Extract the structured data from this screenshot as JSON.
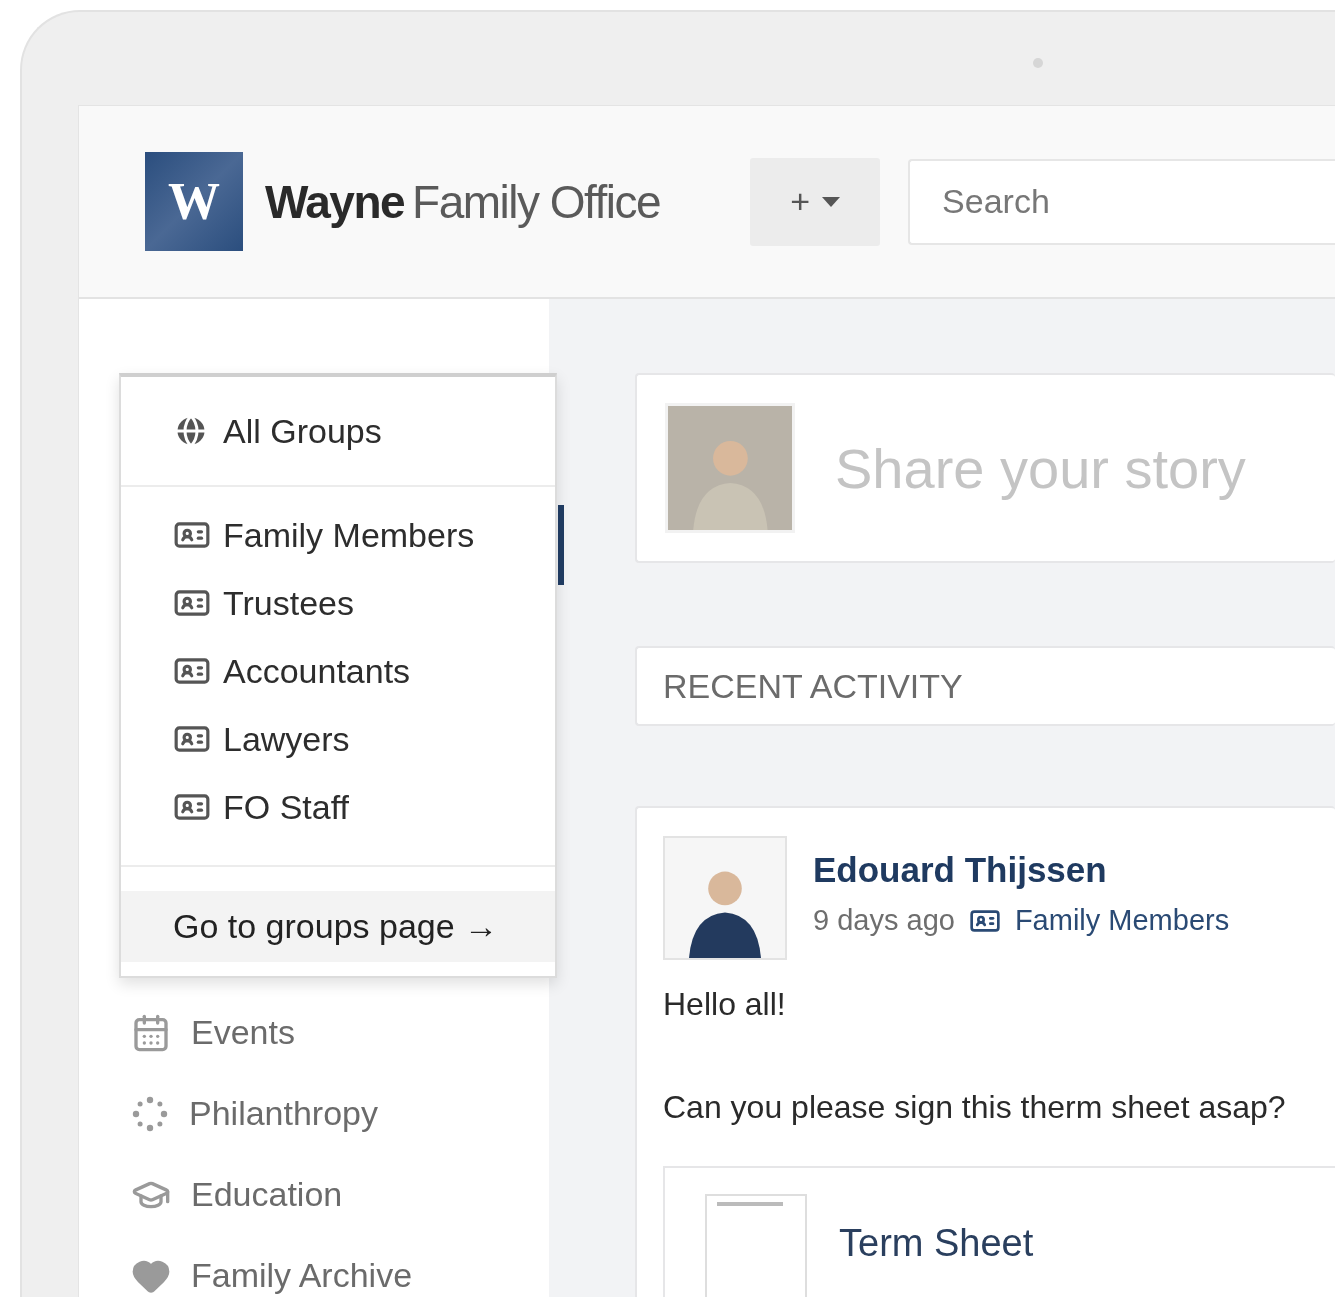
{
  "header": {
    "logo": {
      "letter": "W",
      "name_bold": "Wayne",
      "name_light": "Family Office"
    },
    "add_button": {
      "label": "+"
    },
    "search": {
      "placeholder": "Search"
    }
  },
  "groups_menu": {
    "all_label": "All Groups",
    "groups": [
      {
        "label": "Family Members",
        "selected": true
      },
      {
        "label": "Trustees",
        "selected": false
      },
      {
        "label": "Accountants",
        "selected": false
      },
      {
        "label": "Lawyers",
        "selected": false
      },
      {
        "label": "FO Staff",
        "selected": false
      }
    ],
    "footer_link": "Go to groups page →"
  },
  "sidebar": {
    "items": [
      {
        "label": "Events",
        "kind": "calendar"
      },
      {
        "label": "Philanthropy",
        "kind": "dots"
      },
      {
        "label": "Education",
        "kind": "cap"
      },
      {
        "label": "Family Archive",
        "kind": "heart"
      }
    ]
  },
  "composer": {
    "placeholder": "Share your story"
  },
  "recent_activity": {
    "title": "RECENT ACTIVITY"
  },
  "post": {
    "author": "Edouard Thijssen",
    "time": "9 days ago",
    "group": "Family Members",
    "body": [
      "Hello all!",
      "Can you please sign this therm sheet asap?"
    ],
    "attachment": {
      "title": "Term Sheet"
    }
  }
}
